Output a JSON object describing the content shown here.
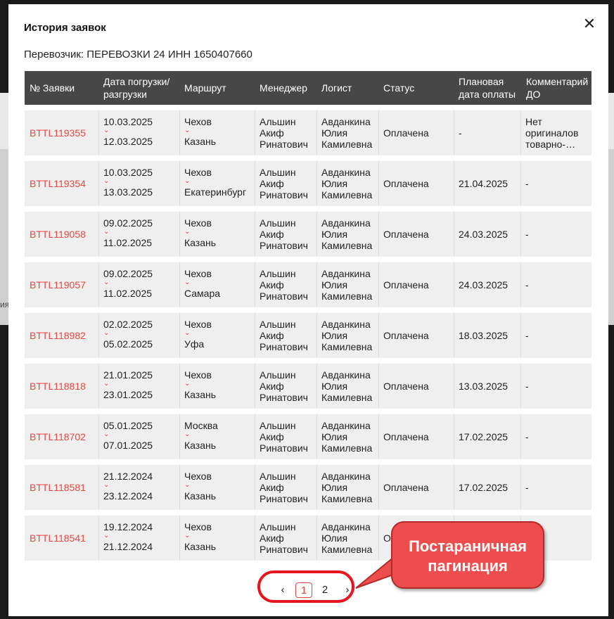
{
  "modal": {
    "title": "История заявок",
    "carrier": "Перевозчик: ПЕРЕВОЗКИ 24 ИНН 1650407660",
    "close_symbol": "✕"
  },
  "background": {
    "fragment_text": "ия"
  },
  "table": {
    "columns": [
      {
        "line1": "№ Заявки",
        "line2": ""
      },
      {
        "line1": "Дата погрузки/",
        "line2": "разгрузки"
      },
      {
        "line1": "Маршрут",
        "line2": ""
      },
      {
        "line1": "Менеджер",
        "line2": ""
      },
      {
        "line1": "Логист",
        "line2": ""
      },
      {
        "line1": "Статус",
        "line2": ""
      },
      {
        "line1": "Плановая",
        "line2": "дата оплаты"
      },
      {
        "line1": "Комментарий",
        "line2": "ДО"
      }
    ],
    "rows": [
      {
        "id": "BTTL119355",
        "load": "10.03.2025",
        "unload": "12.03.2025",
        "from": "Чехов",
        "to": "Казань",
        "manager": [
          "Альшин",
          "Акиф",
          "Ринатович"
        ],
        "logist": [
          "Авданкина",
          "Юлия",
          "Камилевна"
        ],
        "status": "Оплачена",
        "paydate": "-",
        "comment": [
          "Нет",
          "оригиналов",
          "товарно-…"
        ]
      },
      {
        "id": "BTTL119354",
        "load": "10.03.2025",
        "unload": "13.03.2025",
        "from": "Чехов",
        "to": "Екатеринбург",
        "manager": [
          "Альшин",
          "Акиф",
          "Ринатович"
        ],
        "logist": [
          "Авданкина",
          "Юлия",
          "Камилевна"
        ],
        "status": "Оплачена",
        "paydate": "21.04.2025",
        "comment": [
          "-"
        ]
      },
      {
        "id": "BTTL119058",
        "load": "09.02.2025",
        "unload": "11.02.2025",
        "from": "Чехов",
        "to": "Казань",
        "manager": [
          "Альшин",
          "Акиф",
          "Ринатович"
        ],
        "logist": [
          "Авданкина",
          "Юлия",
          "Камилевна"
        ],
        "status": "Оплачена",
        "paydate": "24.03.2025",
        "comment": [
          "-"
        ]
      },
      {
        "id": "BTTL119057",
        "load": "09.02.2025",
        "unload": "11.02.2025",
        "from": "Чехов",
        "to": "Самара",
        "manager": [
          "Альшин",
          "Акиф",
          "Ринатович"
        ],
        "logist": [
          "Авданкина",
          "Юлия",
          "Камилевна"
        ],
        "status": "Оплачена",
        "paydate": "24.03.2025",
        "comment": [
          "-"
        ]
      },
      {
        "id": "BTTL118982",
        "load": "02.02.2025",
        "unload": "05.02.2025",
        "from": "Чехов",
        "to": "Уфа",
        "manager": [
          "Альшин",
          "Акиф",
          "Ринатович"
        ],
        "logist": [
          "Авданкина",
          "Юлия",
          "Камилевна"
        ],
        "status": "Оплачена",
        "paydate": "18.03.2025",
        "comment": [
          "-"
        ]
      },
      {
        "id": "BTTL118818",
        "load": "21.01.2025",
        "unload": "23.01.2025",
        "from": "Чехов",
        "to": "Казань",
        "manager": [
          "Альшин",
          "Акиф",
          "Ринатович"
        ],
        "logist": [
          "Авданкина",
          "Юлия",
          "Камилевна"
        ],
        "status": "Оплачена",
        "paydate": "13.03.2025",
        "comment": [
          "-"
        ]
      },
      {
        "id": "BTTL118702",
        "load": "05.01.2025",
        "unload": "07.01.2025",
        "from": "Москва",
        "to": "Казань",
        "manager": [
          "Альшин",
          "Акиф",
          "Ринатович"
        ],
        "logist": [
          "Авданкина",
          "Юлия",
          "Камилевна"
        ],
        "status": "Оплачена",
        "paydate": "17.02.2025",
        "comment": [
          "-"
        ]
      },
      {
        "id": "BTTL118581",
        "load": "21.12.2024",
        "unload": "23.12.2024",
        "from": "Чехов",
        "to": "Казань",
        "manager": [
          "Альшин",
          "Акиф",
          "Ринатович"
        ],
        "logist": [
          "Авданкина",
          "Юлия",
          "Камилевна"
        ],
        "status": "Оплачена",
        "paydate": "17.02.2025",
        "comment": [
          "-"
        ]
      },
      {
        "id": "BTTL118541",
        "load": "19.12.2024",
        "unload": "21.12.2024",
        "from": "Чехов",
        "to": "Казань",
        "manager": [
          "Альшин",
          "Акиф",
          "Ринатович"
        ],
        "logist": [
          "Авданкина",
          "Юлия",
          "Камилевна"
        ],
        "status": "О",
        "paydate": "",
        "comment": [
          ""
        ]
      }
    ]
  },
  "pagination": {
    "prev_symbol": "‹",
    "pages": [
      "1",
      "2"
    ],
    "current": "1",
    "next_symbol": "›"
  },
  "annotation": {
    "line1": "Постараничная",
    "line2": "пагинация",
    "color": "#e5161e"
  },
  "colors": {
    "accent": "#e04a3f",
    "header_bg": "#474747",
    "row_bg": "#efefef"
  },
  "icons": {
    "close": "close-icon",
    "chevron": "chevron-down-icon",
    "prev": "chevron-left-icon",
    "next": "chevron-right-icon"
  }
}
